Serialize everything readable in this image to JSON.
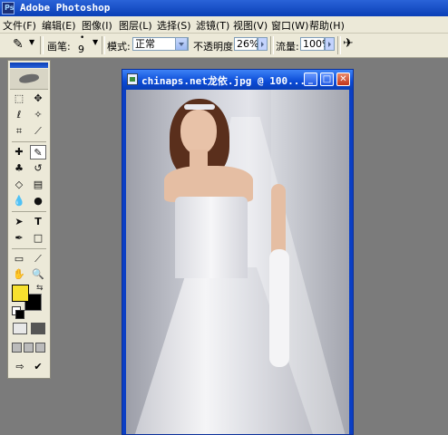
{
  "app": {
    "title": "Adobe Photoshop"
  },
  "menu": [
    "文件(F)",
    "编辑(E)",
    "图像(I)",
    "图层(L)",
    "选择(S)",
    "滤镜(T)",
    "视图(V)",
    "窗口(W)",
    "帮助(H)"
  ],
  "options": {
    "brush_label": "画笔:",
    "brush_size": "9",
    "mode_label": "模式:",
    "mode_value": "正常",
    "opacity_label": "不透明度:",
    "opacity_value": "26%",
    "flow_label": "流量:",
    "flow_value": "100%"
  },
  "document": {
    "title": "chinaps.net龙依.jpg @ 100..."
  },
  "colors": {
    "foreground": "#f7e12e",
    "background": "#000000",
    "titlebar": "#0a3fb6"
  }
}
